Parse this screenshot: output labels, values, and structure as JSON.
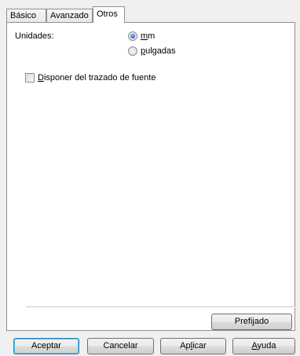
{
  "tabs": [
    {
      "label": "Básico"
    },
    {
      "label": "Avanzado"
    },
    {
      "label": "Otros"
    }
  ],
  "units": {
    "label": "Unidades:",
    "options": [
      {
        "accel": "m",
        "rest": "m",
        "checked": true
      },
      {
        "accel": "p",
        "rest": "ulgadas",
        "checked": false
      }
    ]
  },
  "outline": {
    "accel": "D",
    "rest": "isponer del trazado de fuente",
    "checked": false
  },
  "defaults_button": {
    "label": "Prefijado"
  },
  "footer": {
    "ok": {
      "label": "Aceptar"
    },
    "cancel": {
      "label": "Cancelar"
    },
    "apply": {
      "before": "Ap",
      "accel": "l",
      "after": "icar"
    },
    "help": {
      "accel": "A",
      "rest": "yuda"
    }
  }
}
